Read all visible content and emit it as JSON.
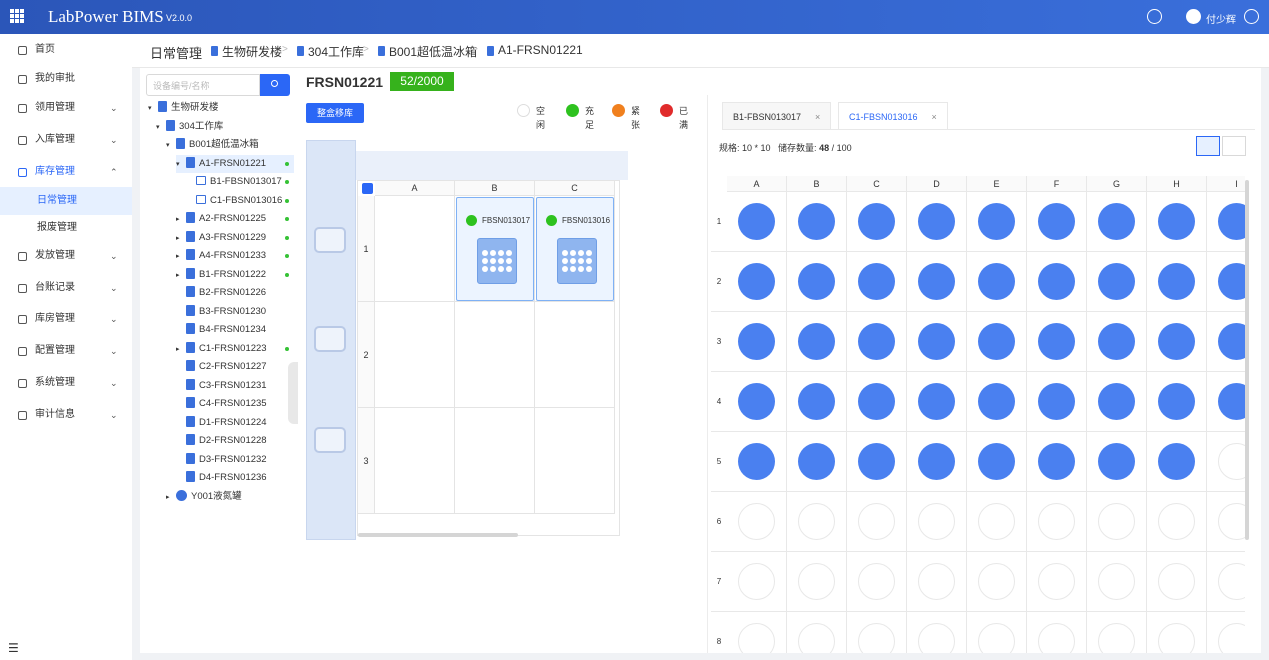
{
  "app": {
    "logo": "LabPower BIMS",
    "version": "V2.0.0",
    "user": "付少辉",
    "icons": [
      "grid-menu-icon",
      "message-icon",
      "user-avatar-icon",
      "logout-icon"
    ]
  },
  "sidebar": {
    "items": [
      {
        "label": "首页",
        "icon": "home-icon",
        "chevron": ""
      },
      {
        "label": "我的审批",
        "icon": "approval-icon",
        "chevron": ""
      },
      {
        "label": "领用管理",
        "icon": "receive-icon",
        "chevron": "⌄"
      },
      {
        "label": "入库管理",
        "icon": "inbound-icon",
        "chevron": "⌄"
      },
      {
        "label": "库存管理",
        "icon": "inventory-icon",
        "chevron": "⌃"
      },
      {
        "label": "日常管理",
        "icon": "",
        "chevron": ""
      },
      {
        "label": "报废管理",
        "icon": "",
        "chevron": ""
      },
      {
        "label": "发放管理",
        "icon": "distribute-icon",
        "chevron": "⌄"
      },
      {
        "label": "台账记录",
        "icon": "ledger-icon",
        "chevron": "⌄"
      },
      {
        "label": "库房管理",
        "icon": "warehouse-icon",
        "chevron": "⌄"
      },
      {
        "label": "配置管理",
        "icon": "config-icon",
        "chevron": "⌄"
      },
      {
        "label": "系统管理",
        "icon": "system-icon",
        "chevron": "⌄"
      },
      {
        "label": "审计信息",
        "icon": "audit-icon",
        "chevron": "⌄"
      }
    ]
  },
  "breadcrumb": [
    "日常管理",
    "生物研发楼",
    "304工作库",
    "B001超低温冰箱",
    "A1-FRSN01221"
  ],
  "search": {
    "placeholder": "设备编号/名称"
  },
  "tree": [
    {
      "label": "生物研发楼",
      "arrow": "▾",
      "icon": "building-icon",
      "dot": false
    },
    {
      "label": "304工作库",
      "arrow": "▾",
      "icon": "room-icon",
      "dot": false
    },
    {
      "label": "B001超低温冰箱",
      "arrow": "▾",
      "icon": "freezer-icon",
      "dot": false
    },
    {
      "label": "A1-FRSN01221",
      "arrow": "▾",
      "icon": "shelf-icon",
      "dot": true
    },
    {
      "label": "B1-FBSN013017",
      "arrow": "",
      "icon": "box-icon",
      "dot": true
    },
    {
      "label": "C1-FBSN013016",
      "arrow": "",
      "icon": "box-icon",
      "dot": true
    },
    {
      "label": "A2-FRSN01225",
      "arrow": "▸",
      "icon": "shelf-icon",
      "dot": true
    },
    {
      "label": "A3-FRSN01229",
      "arrow": "▸",
      "icon": "shelf-icon",
      "dot": true
    },
    {
      "label": "A4-FRSN01233",
      "arrow": "▸",
      "icon": "shelf-icon",
      "dot": true
    },
    {
      "label": "B1-FRSN01222",
      "arrow": "▸",
      "icon": "shelf-icon",
      "dot": true
    },
    {
      "label": "B2-FRSN01226",
      "arrow": "",
      "icon": "shelf-icon",
      "dot": false
    },
    {
      "label": "B3-FRSN01230",
      "arrow": "",
      "icon": "shelf-icon",
      "dot": false
    },
    {
      "label": "B4-FRSN01234",
      "arrow": "",
      "icon": "shelf-icon",
      "dot": false
    },
    {
      "label": "C1-FRSN01223",
      "arrow": "▸",
      "icon": "shelf-icon",
      "dot": true
    },
    {
      "label": "C2-FRSN01227",
      "arrow": "",
      "icon": "shelf-icon",
      "dot": false
    },
    {
      "label": "C3-FRSN01231",
      "arrow": "",
      "icon": "shelf-icon",
      "dot": false
    },
    {
      "label": "C4-FRSN01235",
      "arrow": "",
      "icon": "shelf-icon",
      "dot": false
    },
    {
      "label": "D1-FRSN01224",
      "arrow": "",
      "icon": "shelf-icon",
      "dot": false
    },
    {
      "label": "D2-FRSN01228",
      "arrow": "",
      "icon": "shelf-icon",
      "dot": false
    },
    {
      "label": "D3-FRSN01232",
      "arrow": "",
      "icon": "shelf-icon",
      "dot": false
    },
    {
      "label": "D4-FRSN01236",
      "arrow": "",
      "icon": "shelf-icon",
      "dot": false
    },
    {
      "label": "Y001液氮罐",
      "arrow": "▸",
      "icon": "tank-icon",
      "dot": false
    }
  ],
  "middle": {
    "title": "FRSN01221",
    "capacity": "52/2000",
    "move_button": "整盒移库",
    "legend": [
      {
        "label": "空闲",
        "color": "#ffffff"
      },
      {
        "label": "充足",
        "color": "#2ec21f"
      },
      {
        "label": "紧张",
        "color": "#f0801e"
      },
      {
        "label": "已满",
        "color": "#e02b2b"
      }
    ],
    "columns": [
      "A",
      "B",
      "C"
    ],
    "rows": [
      "1",
      "2",
      "3"
    ],
    "boxes": [
      {
        "row": 0,
        "col": 1,
        "label": "FBSN013017"
      },
      {
        "row": 0,
        "col": 2,
        "label": "FBSN013016"
      }
    ]
  },
  "right": {
    "tabs": [
      {
        "label": "B1-FBSN013017",
        "active": false
      },
      {
        "label": "C1-FBSN013016",
        "active": true
      }
    ],
    "spec_label": "规格: 10 * 10",
    "stock_label": "储存数量:",
    "stock_count": "48",
    "stock_total": "/ 100",
    "columns": [
      "A",
      "B",
      "C",
      "D",
      "E",
      "F",
      "G",
      "H",
      "I"
    ],
    "rows": [
      "1",
      "2",
      "3",
      "4",
      "5",
      "6",
      "7",
      "8"
    ],
    "occupied_rows": [
      1,
      2,
      3,
      4
    ],
    "row5_occupied_count": 8
  }
}
